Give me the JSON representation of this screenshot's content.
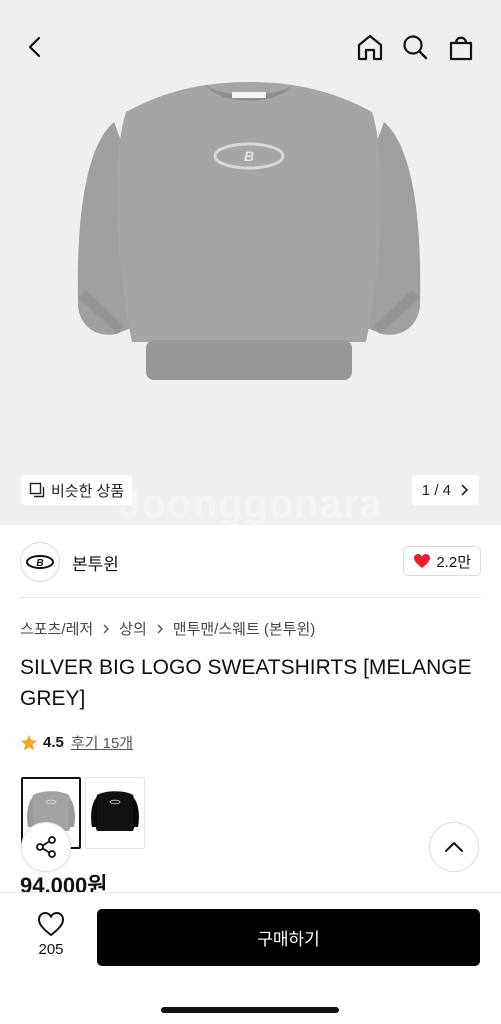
{
  "header": {
    "back_icon": "chevron-left-icon",
    "home_icon": "home-icon",
    "search_icon": "search-icon",
    "bag_icon": "shopping-bag-icon"
  },
  "gallery": {
    "similar_label": "비슷한 상품",
    "current_page": "1",
    "page_separator": "/",
    "total_pages": "4",
    "watermark": "Joonggonara",
    "image_color": "#9a9a9a",
    "background": "#efefef"
  },
  "brand": {
    "name": "본투윈",
    "likes": "2.2만"
  },
  "breadcrumb": [
    "스포츠/레저",
    "상의",
    "맨투맨/스웨트 (본투윈)"
  ],
  "product": {
    "title": "SILVER BIG LOGO SWEATSHIRTS [MELANGE GREY]",
    "rating": "4.5",
    "reviews": "후기 15개",
    "price": "94,000원",
    "colors": [
      {
        "name": "grey",
        "hex": "#a3a3a3",
        "selected": true
      },
      {
        "name": "black",
        "hex": "#111111",
        "selected": false
      }
    ]
  },
  "bottom_bar": {
    "wish_count": "205",
    "buy_label": "구매하기"
  },
  "accent": {
    "heart": "#e8202e",
    "star": "#f5a623",
    "button": "#000000"
  }
}
